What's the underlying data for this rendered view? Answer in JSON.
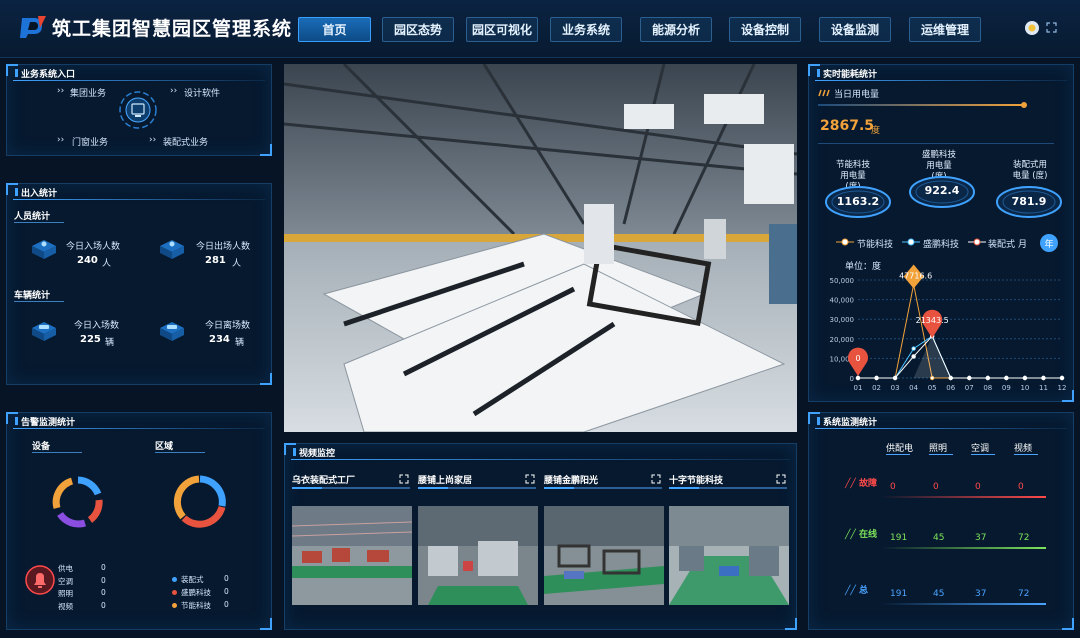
{
  "header": {
    "title": "筑工集团智慧园区管理系统",
    "nav": [
      "首页",
      "园区态势",
      "园区可视化",
      "业务系统",
      "能源分析",
      "设备控制",
      "设备监测",
      "运维管理"
    ],
    "active_index": 0
  },
  "business_entry": {
    "title": "业务系统入口",
    "items": [
      "集团业务",
      "设计软件",
      "门窗业务",
      "装配式业务"
    ]
  },
  "access_stats": {
    "title": "出入统计",
    "people": {
      "title": "人员统计",
      "enter_label": "今日入场人数",
      "enter_value": "240",
      "enter_unit": "人",
      "exit_label": "今日出场人数",
      "exit_value": "281",
      "exit_unit": "人"
    },
    "vehicle": {
      "title": "车辆统计",
      "enter_label": "今日入场数",
      "enter_value": "225",
      "enter_unit": "辆",
      "exit_label": "今日离场数",
      "exit_value": "234",
      "exit_unit": "辆"
    }
  },
  "alarm_stats": {
    "title": "告警监测统计",
    "device_label": "设备",
    "area_label": "区域",
    "device_items": [
      {
        "name": "供电",
        "value": "0"
      },
      {
        "name": "空调",
        "value": "0"
      },
      {
        "name": "照明",
        "value": "0"
      },
      {
        "name": "视频",
        "value": "0"
      }
    ],
    "area_items": [
      {
        "name": "装配式",
        "value": "0",
        "color": "#3fa2ff"
      },
      {
        "name": "盛鹏科技",
        "value": "0",
        "color": "#e8533f"
      },
      {
        "name": "节能科技",
        "value": "0",
        "color": "#f2a23a"
      }
    ]
  },
  "video_monitor": {
    "title": "视频监控",
    "feeds": [
      "乌衣装配式工厂",
      "腰铺上尚家居",
      "腰铺金鹏阳光",
      "十字节能科技"
    ]
  },
  "energy": {
    "title": "实时能耗统计",
    "daily_label": "当日用电量",
    "daily_value": "2867.5",
    "daily_unit": "度",
    "gauges": [
      {
        "label": "节能科技\n用电量\n(度)",
        "value": "1163.2"
      },
      {
        "label": "盛鹏科技\n用电量\n(度)",
        "value": "922.4"
      },
      {
        "label": "装配式用\n电量 (度)",
        "value": "781.9"
      }
    ],
    "legend": [
      "节能科技",
      "盛鹏科技",
      "装配式"
    ],
    "toggle_month": "月",
    "toggle_year": "年",
    "unit_label": "单位：度",
    "marker_peak": "47716.6",
    "marker_mid": "21343.5",
    "marker_start": "0"
  },
  "chart_data": {
    "type": "line",
    "x": [
      "01",
      "02",
      "03",
      "04",
      "05",
      "06",
      "07",
      "08",
      "09",
      "10",
      "11",
      "12"
    ],
    "series": [
      {
        "name": "节能科技",
        "values": [
          0,
          0,
          0,
          47716.6,
          0,
          0,
          0,
          0,
          0,
          0,
          0,
          0
        ]
      },
      {
        "name": "盛鹏科技",
        "values": [
          0,
          0,
          0,
          15000,
          21343.5,
          0,
          0,
          0,
          0,
          0,
          0,
          0
        ]
      },
      {
        "name": "装配式",
        "values": [
          0,
          0,
          0,
          11000,
          21343.5,
          0,
          0,
          0,
          0,
          0,
          0,
          0
        ]
      }
    ],
    "ylim": [
      0,
      50000
    ],
    "yticks": [
      "0",
      "10,000",
      "20,000",
      "30,000",
      "40,000",
      "50,000"
    ],
    "colors": [
      "#f2a23a",
      "#4fc3ff",
      "#ffffff"
    ]
  },
  "system_monitor": {
    "title": "系统监测统计",
    "columns": [
      "供配电",
      "照明",
      "空调",
      "视频"
    ],
    "rows": [
      {
        "label": "故障",
        "values": [
          "0",
          "0",
          "0",
          "0"
        ],
        "color": "#ff4a4a"
      },
      {
        "label": "在线",
        "values": [
          "191",
          "45",
          "37",
          "72"
        ],
        "color": "#7de35b"
      },
      {
        "label": "总",
        "values": [
          "191",
          "45",
          "37",
          "72"
        ],
        "color": "#4aa3ff"
      }
    ]
  }
}
